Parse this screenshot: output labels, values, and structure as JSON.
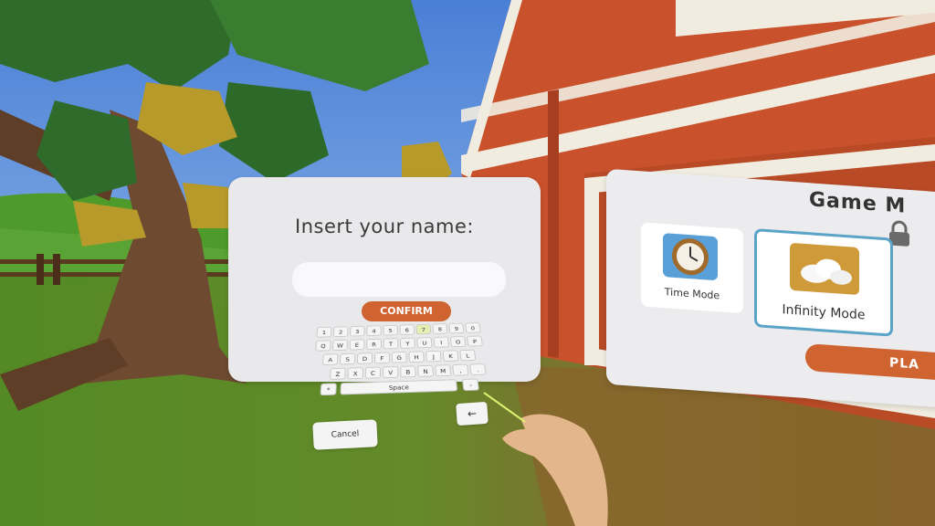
{
  "name_panel": {
    "title": "Insert your name:",
    "input_value": "",
    "confirm_label": "CONFIRM"
  },
  "keyboard": {
    "rows": [
      [
        "1",
        "2",
        "3",
        "4",
        "5",
        "6",
        "7",
        "8",
        "9",
        "0"
      ],
      [
        "Q",
        "W",
        "E",
        "R",
        "T",
        "Y",
        "U",
        "I",
        "O",
        "P"
      ],
      [
        "A",
        "S",
        "D",
        "F",
        "G",
        "H",
        "J",
        "K",
        "L"
      ],
      [
        "Z",
        "X",
        "C",
        "V",
        "B",
        "N",
        "M",
        ",",
        "."
      ]
    ],
    "highlight_key": "7",
    "space_label": "Space",
    "misc_left": "*",
    "misc_right": "-",
    "back_label": "←",
    "cancel_label": "Cancel"
  },
  "game_panel": {
    "title": "Game M",
    "modes": [
      {
        "label": "Time Mode",
        "icon": "clock-icon"
      },
      {
        "label": "Infinity Mode",
        "icon": "clouds-icon",
        "selected": true
      }
    ],
    "play_label": "PLA",
    "lock_icon": "lock-icon"
  },
  "colors": {
    "accent": "#cf6431",
    "selected_border": "#5aa4c8",
    "panel_bg": "#e9e9eb"
  }
}
